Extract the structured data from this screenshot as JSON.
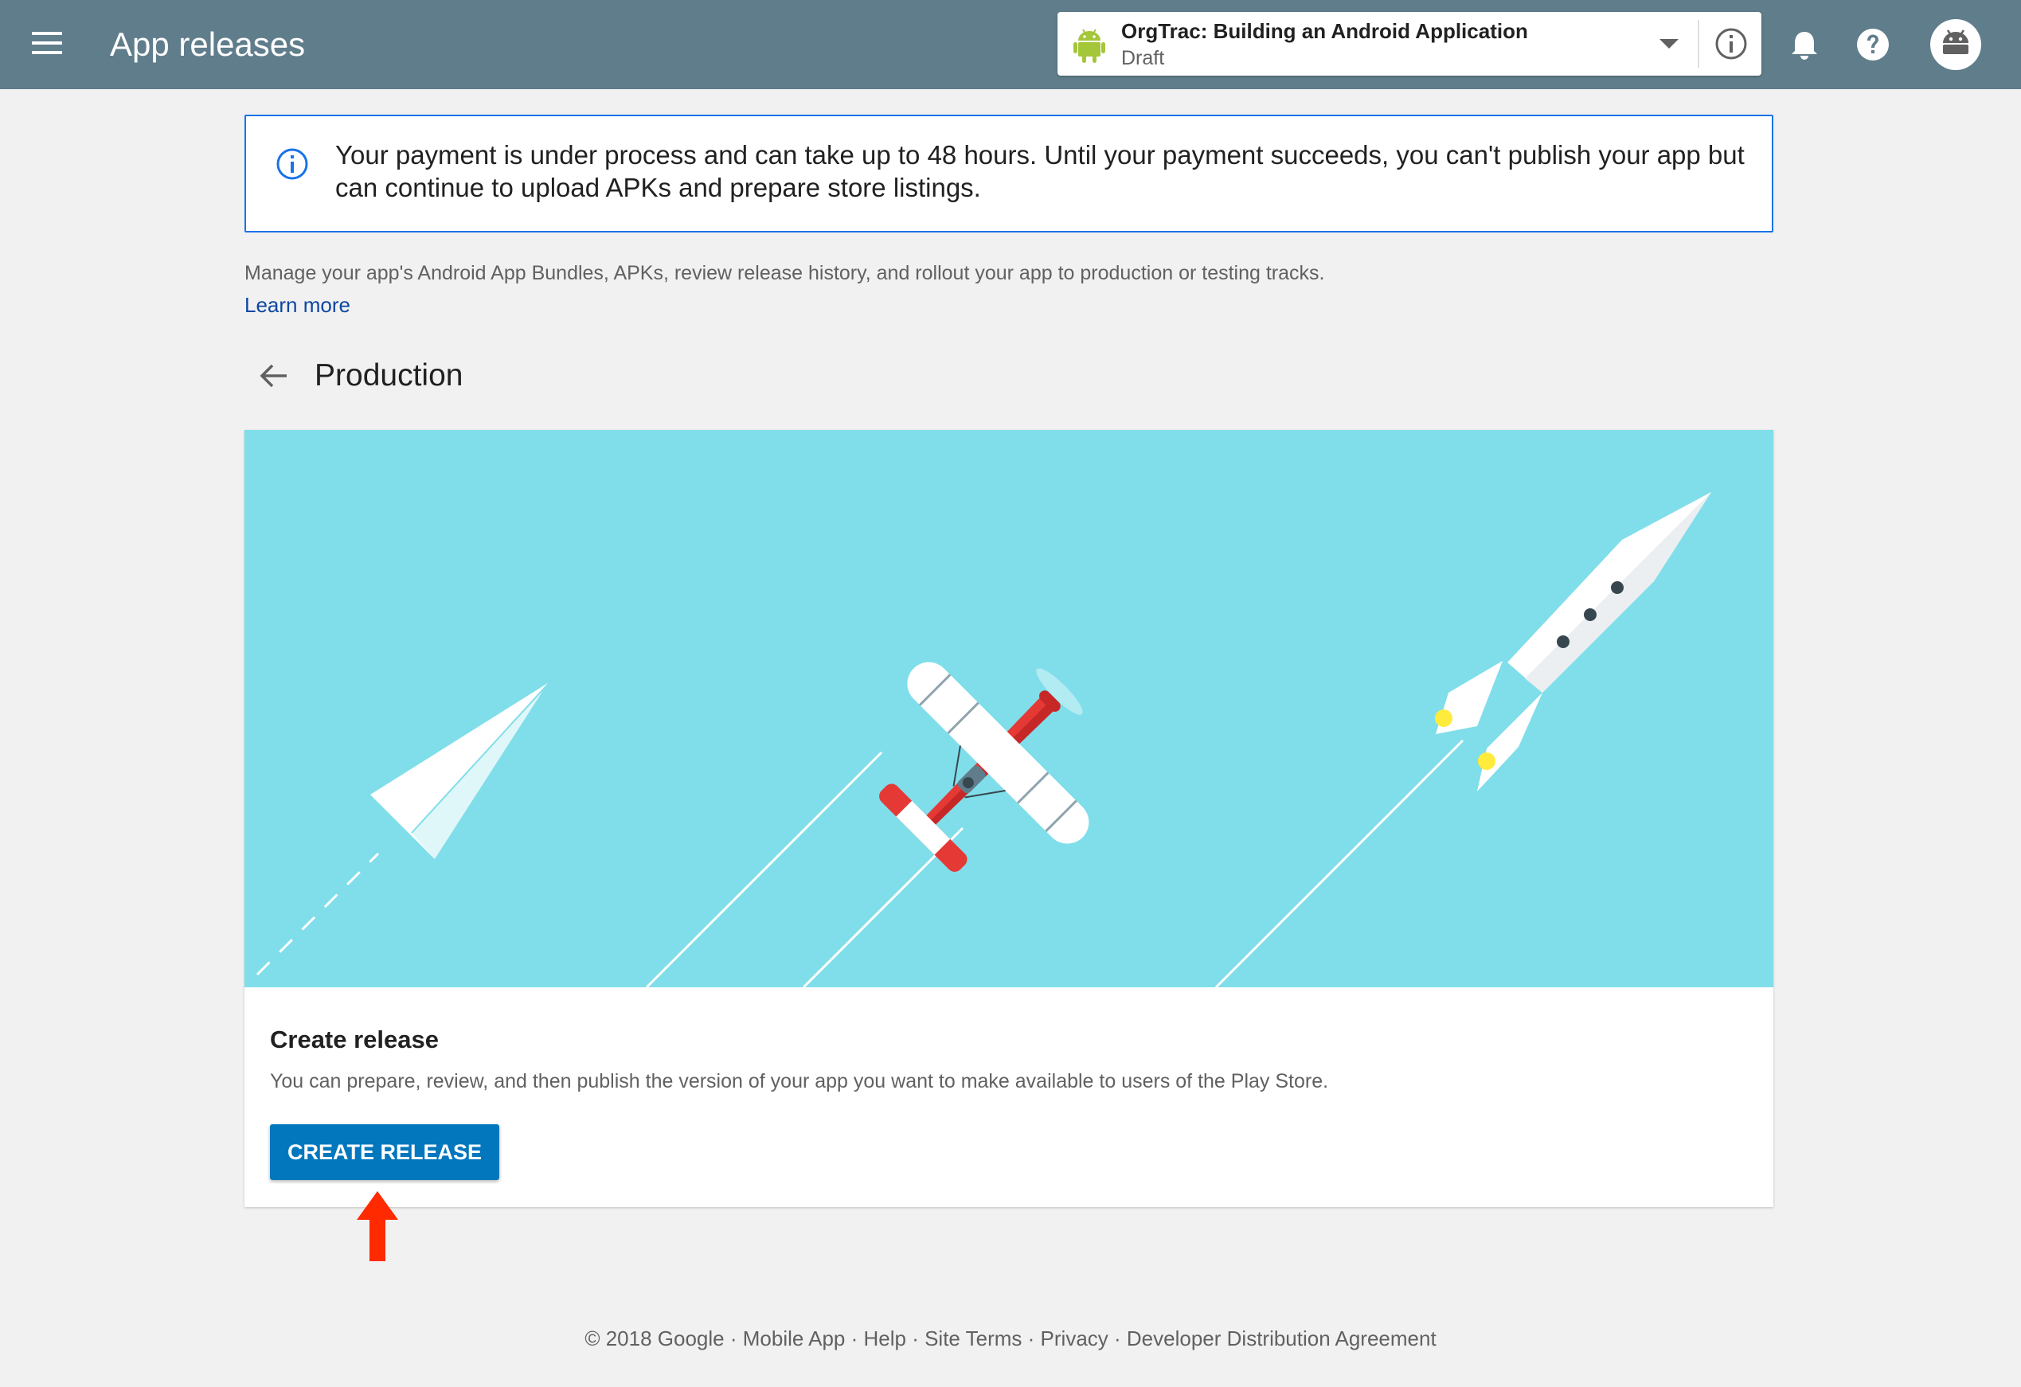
{
  "header": {
    "title": "App releases",
    "app_selector": {
      "app_name": "OrgTrac: Building an Android Application",
      "status": "Draft"
    },
    "icons": {
      "menu": "menu-icon",
      "app": "android-icon",
      "dropdown": "chevron-down-icon",
      "info": "info-icon",
      "notifications": "bell-icon",
      "help": "help-icon",
      "account": "avatar"
    }
  },
  "notice": {
    "icon": "info-icon",
    "text": "Your payment is under process and can take up to 48 hours. Until your payment succeeds, you can't publish your app but can continue to upload APKs and prepare store listings."
  },
  "intro": {
    "description": "Manage your app's Android App Bundles, APKs, review release history, and rollout your app to production or testing tracks.",
    "learn_more": "Learn more"
  },
  "section": {
    "back_icon": "arrow-back-icon",
    "title": "Production"
  },
  "card": {
    "title": "Create release",
    "description": "You can prepare, review, and then publish the version of your app you want to make available to users of the Play Store.",
    "button_label": "CREATE RELEASE"
  },
  "footer": {
    "copyright": "© 2018 Google",
    "links": [
      "Mobile App",
      "Help",
      "Site Terms",
      "Privacy",
      "Developer Distribution Agreement"
    ],
    "separator": " · "
  },
  "colors": {
    "topbar": "#607d8b",
    "accent": "#0277bd",
    "banner": "#80deea",
    "notice_border": "#1a73e8",
    "annotation_arrow": "#ff2a00"
  }
}
